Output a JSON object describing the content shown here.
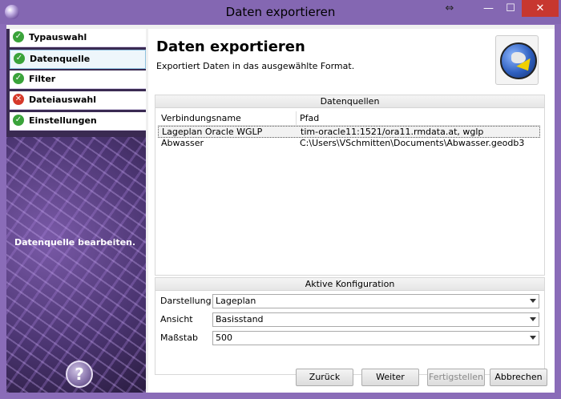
{
  "window": {
    "title": "Daten exportieren",
    "close_glyph": "✕",
    "minimize_glyph": "—",
    "maximize_glyph": "☐",
    "arrows_glyph": "⇔"
  },
  "sidebar": {
    "items": [
      {
        "label": "Typauswahl",
        "status": "ok"
      },
      {
        "label": "Datenquelle",
        "status": "ok",
        "active": true
      },
      {
        "label": "Filter",
        "status": "ok"
      },
      {
        "label": "Dateiauswahl",
        "status": "error"
      },
      {
        "label": "Einstellungen",
        "status": "ok"
      }
    ],
    "caption": "Datenquelle bearbeiten.",
    "help_glyph": "?"
  },
  "header": {
    "title": "Daten exportieren",
    "subtitle": "Exportiert Daten in das ausgewählte Format."
  },
  "datasources": {
    "title": "Datenquellen",
    "columns": [
      "Verbindungsname",
      "Pfad"
    ],
    "rows": [
      {
        "name": "Lageplan Oracle WGLP",
        "path": "tim-oracle11:1521/ora11.rmdata.at, wglp"
      },
      {
        "name": "Abwasser",
        "path": "C:\\Users\\VSchmitten\\Documents\\Abwasser.geodb3"
      }
    ]
  },
  "config": {
    "title": "Aktive Konfiguration",
    "fields": [
      {
        "label": "Darstellung",
        "value": "Lageplan"
      },
      {
        "label": "Ansicht",
        "value": "Basisstand"
      },
      {
        "label": "Maßstab",
        "value": "500"
      }
    ]
  },
  "buttons": {
    "back": "Zurück",
    "next": "Weiter",
    "finish": "Fertigstellen",
    "cancel": "Abbrechen"
  },
  "colors": {
    "accent": "#8467b2",
    "close": "#c7372f",
    "ok": "#3aa33a",
    "error": "#d63a2a"
  }
}
